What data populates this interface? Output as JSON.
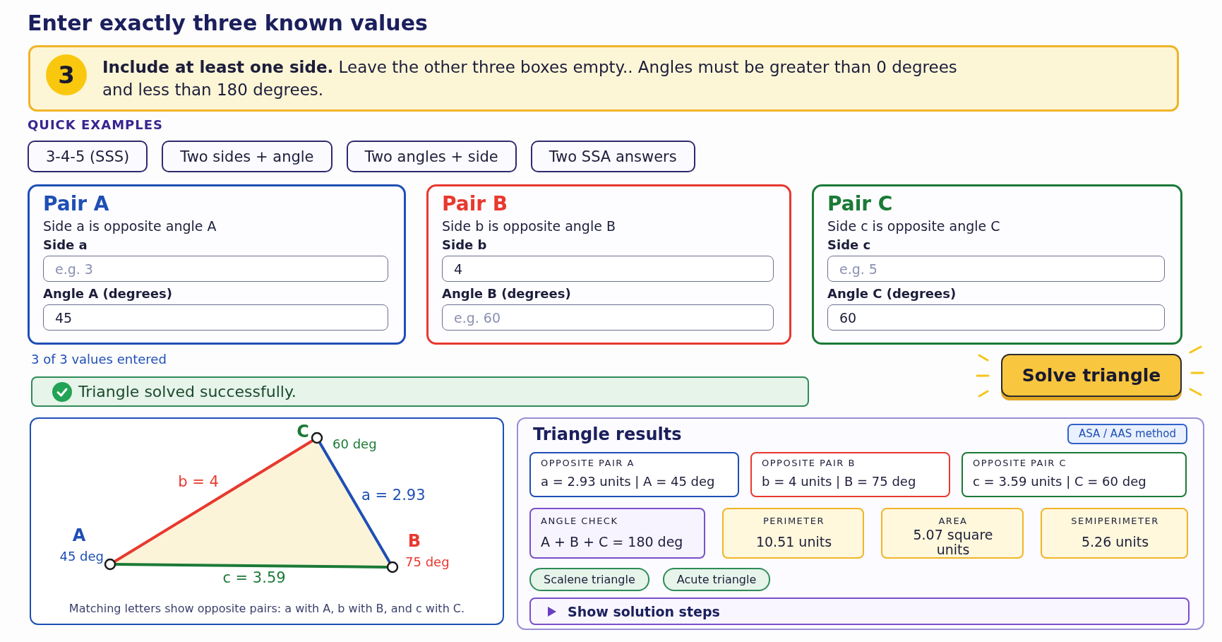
{
  "title": "Enter exactly three known values",
  "notice": {
    "number": "3",
    "text": "**Include at least one side.** Leave the other three boxes empty.. Angles must be greater than 0 degrees and less than 180 degrees."
  },
  "quick_examples": {
    "heading": "QUICK EXAMPLES",
    "buttons": [
      "3-4-5 (SSS)",
      "Two sides + angle",
      "Two angles + side",
      "Two SSA answers"
    ]
  },
  "pairs": [
    {
      "title": "Pair A",
      "color": "#1f4fb5",
      "description": "Side a is opposite angle A",
      "side": {
        "label": "Side a",
        "placeholder": "e.g. 3"
      },
      "angle": {
        "label": "Angle A (degrees)",
        "value": "45"
      }
    },
    {
      "title": "Pair B",
      "color": "#e8392f",
      "description": "Side b is opposite angle B",
      "side": {
        "label": "Side b",
        "value": "4"
      },
      "angle": {
        "label": "Angle B (degrees)",
        "placeholder": "e.g. 60"
      }
    },
    {
      "title": "Pair C",
      "color": "#1b7a36",
      "description": "Side c is opposite angle C",
      "side": {
        "label": "Side c",
        "placeholder": "e.g. 5"
      },
      "angle": {
        "label": "Angle C (degrees)",
        "value": "60"
      }
    }
  ],
  "values_count": "3 of 3 values entered",
  "status": {
    "kind": "success",
    "message": "Triangle solved successfully."
  },
  "solve_button": "Solve triangle",
  "diagram": {
    "vertices": [
      {
        "label": "A",
        "angle": "45 deg"
      },
      {
        "label": "B",
        "angle": "75 deg"
      },
      {
        "label": "C",
        "angle": "60 deg"
      }
    ],
    "sides": [
      "a = 2.93",
      "b = 4",
      "c = 3.59"
    ],
    "caption": "Matching letters show opposite pairs: a with A, b with B, and c with C."
  },
  "results": {
    "title": "Triangle results",
    "method": "ASA / AAS method",
    "pairs": [
      {
        "label": "OPPOSITE PAIR A",
        "value": "a = 2.93 units | A = 45 deg"
      },
      {
        "label": "OPPOSITE PAIR B",
        "value": "b = 4 units | B = 75 deg"
      },
      {
        "label": "OPPOSITE PAIR C",
        "value": "c = 3.59 units | C = 60 deg"
      }
    ],
    "metrics": [
      {
        "kind": "check",
        "label": "ANGLE CHECK",
        "value": "A + B + C = 180 deg"
      },
      {
        "kind": "measure",
        "label": "PERIMETER",
        "value": "10.51 units"
      },
      {
        "kind": "measure",
        "label": "AREA",
        "value": "5.07 square units"
      },
      {
        "kind": "measure",
        "label": "SEMIPERIMETER",
        "value": "5.26 units"
      }
    ],
    "tags": [
      "Scalene triangle",
      "Acute triangle"
    ],
    "steps": {
      "label": "Show solution steps",
      "expanded": false
    }
  }
}
